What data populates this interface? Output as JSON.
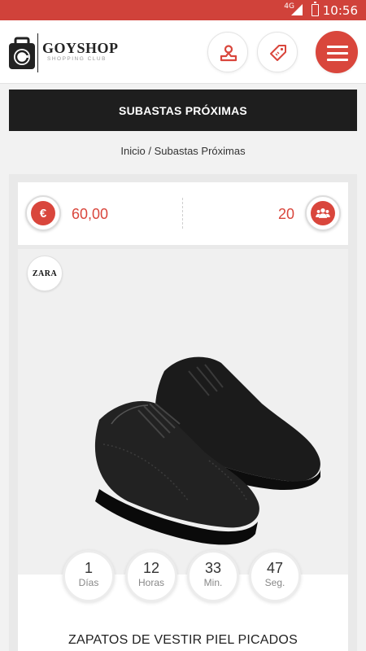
{
  "status_bar": {
    "network": "4G",
    "time": "10:56"
  },
  "header": {
    "logo_name": "GOYSHOP",
    "logo_tagline": "SHOPPING CLUB",
    "icons": {
      "account": "user-icon",
      "tag": "price-tag-icon",
      "menu": "hamburger-menu-icon"
    }
  },
  "page": {
    "title": "SUBASTAS PRÓXIMAS",
    "breadcrumb": {
      "home": "Inicio",
      "separator": " / ",
      "current": "Subastas Próximas"
    }
  },
  "auction": {
    "currency_symbol": "€",
    "price": "60,00",
    "bidders": "20",
    "brand": "ZARA",
    "product_name": "ZAPATOS DE VESTIR PIEL PICADOS",
    "countdown": {
      "days": {
        "value": "1",
        "label": "Días"
      },
      "hours": {
        "value": "12",
        "label": "Horas"
      },
      "minutes": {
        "value": "33",
        "label": "Min."
      },
      "seconds": {
        "value": "47",
        "label": "Seg."
      }
    }
  },
  "colors": {
    "accent": "#d9463c",
    "title_bar": "#1e1e1e",
    "status_bar": "#d0423a"
  }
}
